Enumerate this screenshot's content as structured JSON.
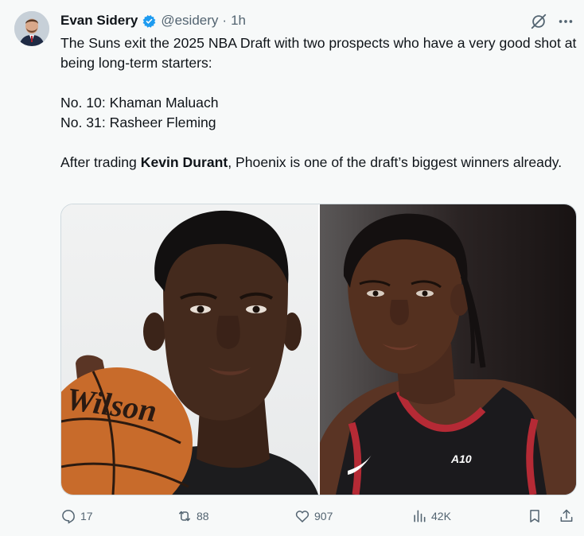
{
  "author": {
    "display_name": "Evan Sidery",
    "handle": "@esidery",
    "separator": "·",
    "time": "1h",
    "verified": true,
    "verified_color": "#1d9bf0"
  },
  "tweet": {
    "line1": "The Suns exit the 2025 NBA Draft with two prospects who have a very good shot at being long-term starters:",
    "pick1": "No. 10: Khaman Maluach",
    "pick2": "No. 31: Rasheer Fleming",
    "line3_before": "After trading ",
    "line3_bold": "Kevin Durant",
    "line3_after": ", Phoenix is one of the draft’s biggest winners already."
  },
  "media": {
    "left_photo_icon": "player-portrait-photo",
    "right_photo_icon": "player-portrait-photo",
    "basketball_text": "Wilson",
    "jersey_text": "A10"
  },
  "actions": {
    "replies": "17",
    "reposts": "88",
    "likes": "907",
    "views": "42K"
  },
  "colors": {
    "text": "#0f1419",
    "secondary": "#536471",
    "background": "#f7f9f9",
    "accent": "#1d9bf0"
  }
}
